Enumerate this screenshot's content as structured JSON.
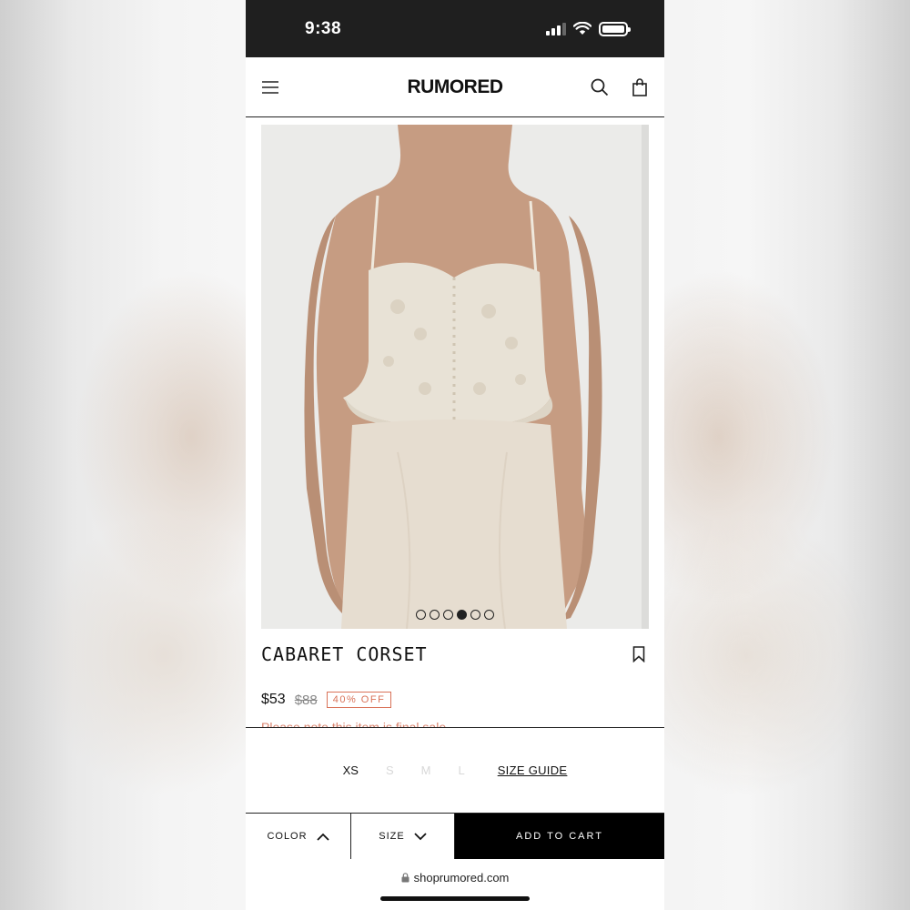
{
  "status_bar": {
    "time": "9:38"
  },
  "header": {
    "brand": "RUMORED"
  },
  "product": {
    "title": "CABARET CORSET",
    "price": "$53",
    "original_price": "$88",
    "discount_badge": "40% OFF",
    "note": "Please note this item is final sale",
    "image_count": 6,
    "active_image_index": 4
  },
  "sizes": {
    "options": [
      {
        "label": "XS",
        "available": true
      },
      {
        "label": "S",
        "available": false
      },
      {
        "label": "M",
        "available": false
      },
      {
        "label": "L",
        "available": false
      }
    ],
    "size_guide_label": "SIZE GUIDE"
  },
  "action_bar": {
    "color_label": "COLOR",
    "size_label": "SIZE",
    "add_to_cart_label": "ADD TO CART"
  },
  "browser": {
    "url": "shoprumored.com"
  },
  "colors": {
    "accent": "#d97258",
    "cart_bg": "#000000",
    "status_bar_bg": "#1f1f1f"
  }
}
